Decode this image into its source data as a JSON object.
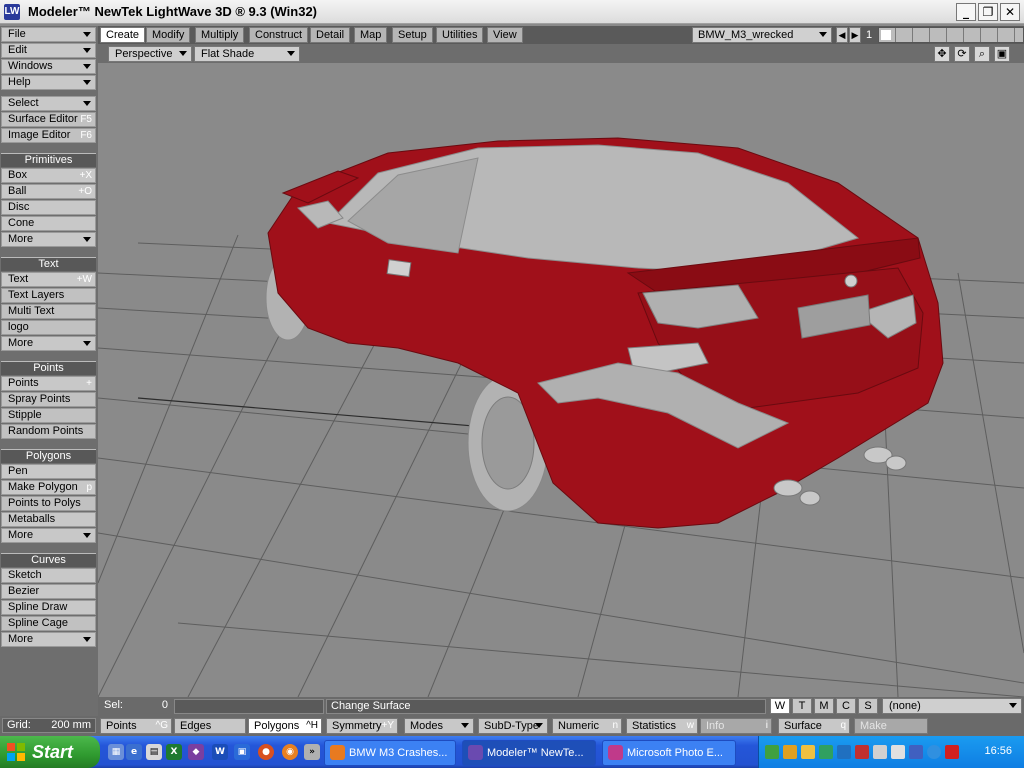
{
  "window": {
    "icon_text": "LW",
    "title": "Modeler™ NewTek LightWave 3D ® 9.3 (Win32)",
    "minimize": "_",
    "maximize": "❐",
    "close": "✕"
  },
  "left_panel": {
    "menus": [
      {
        "label": "File"
      },
      {
        "label": "Edit"
      },
      {
        "label": "Windows"
      },
      {
        "label": "Help"
      }
    ],
    "select": {
      "label": "Select"
    },
    "surface_editor": {
      "label": "Surface Editor",
      "key": "F5"
    },
    "image_editor": {
      "label": "Image Editor",
      "key": "F6"
    },
    "primitives": {
      "header": "Primitives",
      "items": [
        {
          "label": "Box",
          "key": "+X"
        },
        {
          "label": "Ball",
          "key": "+O"
        },
        {
          "label": "Disc",
          "key": ""
        },
        {
          "label": "Cone",
          "key": ""
        }
      ],
      "more": "More"
    },
    "text": {
      "header": "Text",
      "items": [
        {
          "label": "Text",
          "key": "+W"
        },
        {
          "label": "Text Layers",
          "key": ""
        },
        {
          "label": "Multi Text",
          "key": ""
        },
        {
          "label": "logo",
          "key": ""
        }
      ],
      "more": "More"
    },
    "points": {
      "header": "Points",
      "items": [
        {
          "label": "Points",
          "key": "+"
        },
        {
          "label": "Spray Points",
          "key": ""
        },
        {
          "label": "Stipple",
          "key": ""
        },
        {
          "label": "Random Points",
          "key": ""
        }
      ]
    },
    "polygons": {
      "header": "Polygons",
      "items": [
        {
          "label": "Pen",
          "key": ""
        },
        {
          "label": "Make Polygon",
          "key": "p"
        },
        {
          "label": "Points to Polys",
          "key": ""
        },
        {
          "label": "Metaballs",
          "key": ""
        }
      ],
      "more": "More"
    },
    "curves": {
      "header": "Curves",
      "items": [
        {
          "label": "Sketch"
        },
        {
          "label": "Bezier"
        },
        {
          "label": "Spline Draw"
        },
        {
          "label": "Spline Cage"
        }
      ],
      "more": "More"
    }
  },
  "tabs": [
    "Create",
    "Modify",
    "Multiply",
    "Construct",
    "Detail",
    "Map",
    "Setup",
    "Utilities",
    "View"
  ],
  "active_tab": "Create",
  "object_selector": "BMW_M3_wrecked",
  "layer_number": "1",
  "viewport_bar": {
    "view": "Perspective",
    "shading": "Flat Shade"
  },
  "status_bar": {
    "sel_label": "Sel:",
    "sel_value": "0",
    "message": "Change Surface",
    "wtmcs": [
      "W",
      "T",
      "M",
      "C",
      "S"
    ],
    "surface": "(none)"
  },
  "bottom_bar": {
    "grid_label": "Grid:",
    "grid_value": "200 mm",
    "points": {
      "label": "Points",
      "key": "^G"
    },
    "edges": {
      "label": "Edges"
    },
    "polygons": {
      "label": "Polygons",
      "key": "^H"
    },
    "symmetry": {
      "label": "Symmetry",
      "key": "+Y"
    },
    "modes": "Modes",
    "subd": "SubD-Type",
    "numeric": {
      "label": "Numeric",
      "key": "n"
    },
    "statistics": {
      "label": "Statistics",
      "key": "w"
    },
    "info": {
      "label": "Info",
      "key": "i"
    },
    "surface": {
      "label": "Surface",
      "key": "q"
    },
    "make": "Make"
  },
  "taskbar": {
    "start": "Start",
    "tasks": [
      {
        "label": "BMW M3 Crashes..."
      },
      {
        "label": "Modeler™ NewTe..."
      },
      {
        "label": "Microsoft Photo E..."
      }
    ],
    "clock": "16:56"
  },
  "colors": {
    "car_body": "#a0101a",
    "car_glass": "#b4b4b4",
    "viewport_bg": "#8a8a8a",
    "panel_header": "#585858",
    "button": "#c8c8c8"
  }
}
